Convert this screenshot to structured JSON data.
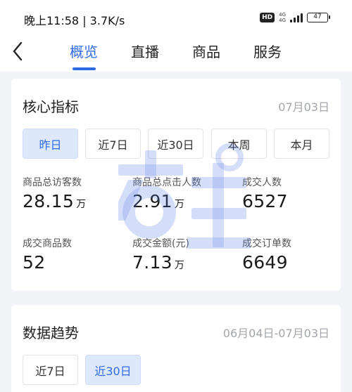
{
  "status_bar": {
    "time_speed": "晚上11:58 | 3.7K/s",
    "hd": "HD",
    "network_top": "4G",
    "network_bottom": "4G",
    "battery": "47"
  },
  "nav": {
    "tabs": [
      {
        "label": "概览",
        "active": true
      },
      {
        "label": "直播",
        "active": false
      },
      {
        "label": "商品",
        "active": false
      },
      {
        "label": "服务",
        "active": false
      }
    ]
  },
  "core_metrics": {
    "title": "核心指标",
    "date": "07月03日",
    "periods": [
      {
        "label": "昨日",
        "active": true
      },
      {
        "label": "近7日",
        "active": false
      },
      {
        "label": "近30日",
        "active": false
      },
      {
        "label": "本周",
        "active": false
      },
      {
        "label": "本月",
        "active": false
      }
    ],
    "metrics": [
      {
        "label": "商品总访客数",
        "value": "28.15",
        "unit": "万"
      },
      {
        "label": "商品总点击人数",
        "value": "2.91",
        "unit": "万"
      },
      {
        "label": "成交人数",
        "value": "6527",
        "unit": ""
      },
      {
        "label": "成交商品数",
        "value": "52",
        "unit": ""
      },
      {
        "label": "成交金额(元)",
        "value": "7.13",
        "unit": "万"
      },
      {
        "label": "成交订单数",
        "value": "6649",
        "unit": ""
      }
    ]
  },
  "trend": {
    "title": "数据趋势",
    "date_range": "06月04日-07月03日",
    "periods": [
      {
        "label": "近7日",
        "active": false
      },
      {
        "label": "近30日",
        "active": true
      }
    ]
  },
  "colors": {
    "accent": "#2f6ae3",
    "chip_active_bg": "#dde8fb",
    "page_bg": "#f3f4f7",
    "muted_text": "#a3a6ad"
  }
}
